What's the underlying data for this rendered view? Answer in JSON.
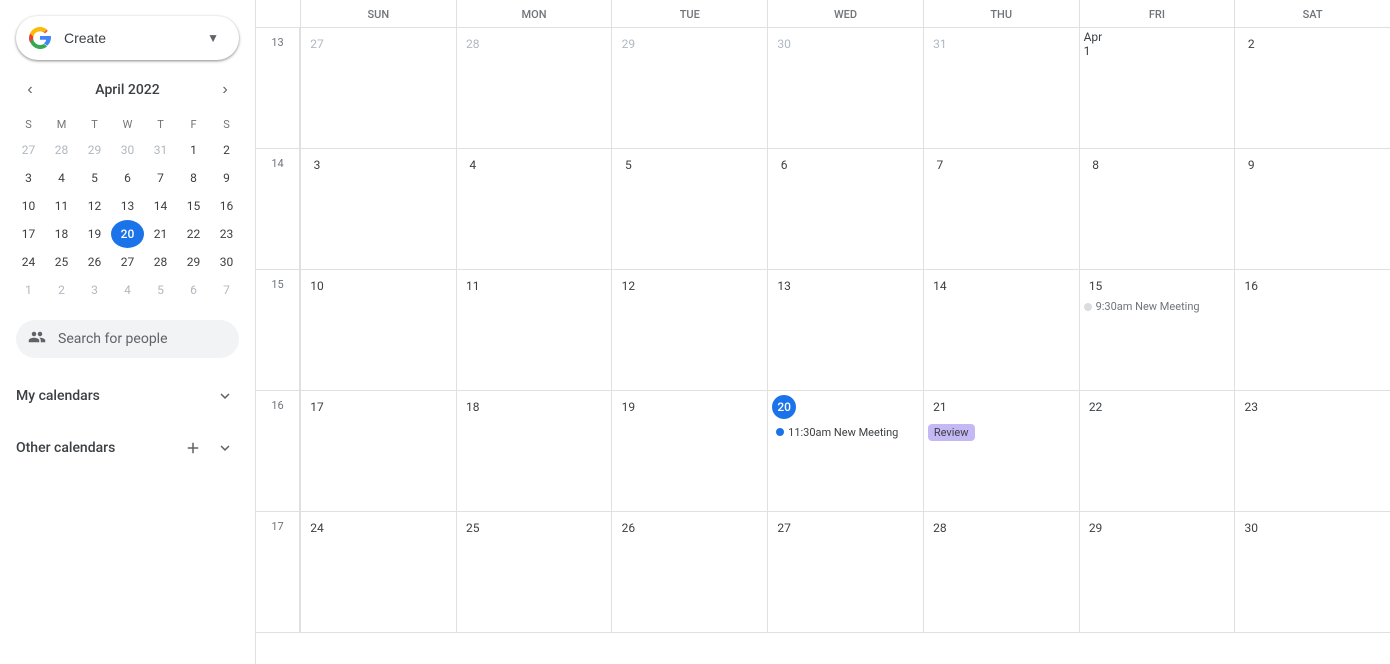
{
  "sidebar": {
    "create_label": "Create",
    "mini_calendar": {
      "title": "April 2022",
      "weekdays": [
        "S",
        "M",
        "T",
        "W",
        "T",
        "F",
        "S"
      ],
      "weeks": [
        [
          {
            "day": 27,
            "other": true
          },
          {
            "day": 28,
            "other": true
          },
          {
            "day": 29,
            "other": true
          },
          {
            "day": 30,
            "other": true
          },
          {
            "day": 31,
            "other": true
          },
          {
            "day": 1,
            "other": false
          },
          {
            "day": 2,
            "other": false
          }
        ],
        [
          {
            "day": 3,
            "other": false
          },
          {
            "day": 4,
            "other": false
          },
          {
            "day": 5,
            "other": false
          },
          {
            "day": 6,
            "other": false
          },
          {
            "day": 7,
            "other": false
          },
          {
            "day": 8,
            "other": false
          },
          {
            "day": 9,
            "other": false
          }
        ],
        [
          {
            "day": 10,
            "other": false
          },
          {
            "day": 11,
            "other": false
          },
          {
            "day": 12,
            "other": false
          },
          {
            "day": 13,
            "other": false
          },
          {
            "day": 14,
            "other": false
          },
          {
            "day": 15,
            "other": false
          },
          {
            "day": 16,
            "other": false
          }
        ],
        [
          {
            "day": 17,
            "other": false
          },
          {
            "day": 18,
            "other": false
          },
          {
            "day": 19,
            "other": false
          },
          {
            "day": 20,
            "other": false,
            "today": true
          },
          {
            "day": 21,
            "other": false
          },
          {
            "day": 22,
            "other": false
          },
          {
            "day": 23,
            "other": false
          }
        ],
        [
          {
            "day": 24,
            "other": false
          },
          {
            "day": 25,
            "other": false
          },
          {
            "day": 26,
            "other": false
          },
          {
            "day": 27,
            "other": false
          },
          {
            "day": 28,
            "other": false
          },
          {
            "day": 29,
            "other": false
          },
          {
            "day": 30,
            "other": false
          }
        ],
        [
          {
            "day": 1,
            "other": true
          },
          {
            "day": 2,
            "other": true
          },
          {
            "day": 3,
            "other": true
          },
          {
            "day": 4,
            "other": true
          },
          {
            "day": 5,
            "other": true
          },
          {
            "day": 6,
            "other": true
          },
          {
            "day": 7,
            "other": true
          }
        ]
      ]
    },
    "search_people_placeholder": "Search for people",
    "my_calendars_label": "My calendars",
    "other_calendars_label": "Other calendars"
  },
  "main": {
    "day_headers": [
      "SUN",
      "MON",
      "TUE",
      "WED",
      "THU",
      "FRI",
      "SAT"
    ],
    "weeks": [
      {
        "week_num": 13,
        "days": [
          {
            "num": 27,
            "other_month": true
          },
          {
            "num": 28,
            "other_month": true
          },
          {
            "num": 29,
            "other_month": true
          },
          {
            "num": 30,
            "other_month": true
          },
          {
            "num": 31,
            "other_month": true
          },
          {
            "num": "Apr 1",
            "other_month": false
          },
          {
            "num": 2,
            "other_month": false
          }
        ],
        "events": []
      },
      {
        "week_num": 14,
        "days": [
          {
            "num": 14,
            "other_month": false
          },
          {
            "num": 3,
            "other_month": false
          },
          {
            "num": 4,
            "other_month": false
          },
          {
            "num": 5,
            "other_month": false
          },
          {
            "num": 6,
            "other_month": false
          },
          {
            "num": 7,
            "other_month": false
          },
          {
            "num": 8,
            "other_month": false
          },
          {
            "num": 9,
            "other_month": false
          }
        ],
        "events": []
      },
      {
        "week_num": 15,
        "days": [
          {
            "num": 15,
            "other_month": false
          },
          {
            "num": 10,
            "other_month": false
          },
          {
            "num": 11,
            "other_month": false
          },
          {
            "num": 12,
            "other_month": false
          },
          {
            "num": 13,
            "other_month": false
          },
          {
            "num": 14,
            "other_month": false
          },
          {
            "num": 15,
            "other_month": false,
            "event_ghost": true,
            "ghost_text": "9:30am New Meeting"
          },
          {
            "num": 16,
            "other_month": false
          }
        ],
        "events": []
      },
      {
        "week_num": 16,
        "days": [
          {
            "num": 16,
            "other_month": false
          },
          {
            "num": 17,
            "other_month": false
          },
          {
            "num": 18,
            "other_month": false
          },
          {
            "num": 19,
            "other_month": false
          },
          {
            "num": 20,
            "other_month": false,
            "today": true,
            "event_dot": true,
            "dot_text": "11:30am New Meeting"
          },
          {
            "num": 21,
            "other_month": false,
            "event_chip": true,
            "chip_text": "Review"
          },
          {
            "num": 22,
            "other_month": false
          },
          {
            "num": 23,
            "other_month": false
          }
        ],
        "events": []
      },
      {
        "week_num": 17,
        "days": [
          {
            "num": 17,
            "other_month": false
          },
          {
            "num": 24,
            "other_month": false
          },
          {
            "num": 25,
            "other_month": false
          },
          {
            "num": 26,
            "other_month": false
          },
          {
            "num": 27,
            "other_month": false
          },
          {
            "num": 28,
            "other_month": false
          },
          {
            "num": 29,
            "other_month": false
          },
          {
            "num": 30,
            "other_month": false
          }
        ],
        "events": []
      }
    ]
  },
  "colors": {
    "today_bg": "#1a73e8",
    "event_chip_bg": "#c5b9f5",
    "dot_color": "#1a73e8",
    "ghost_color": "#dadce0"
  }
}
